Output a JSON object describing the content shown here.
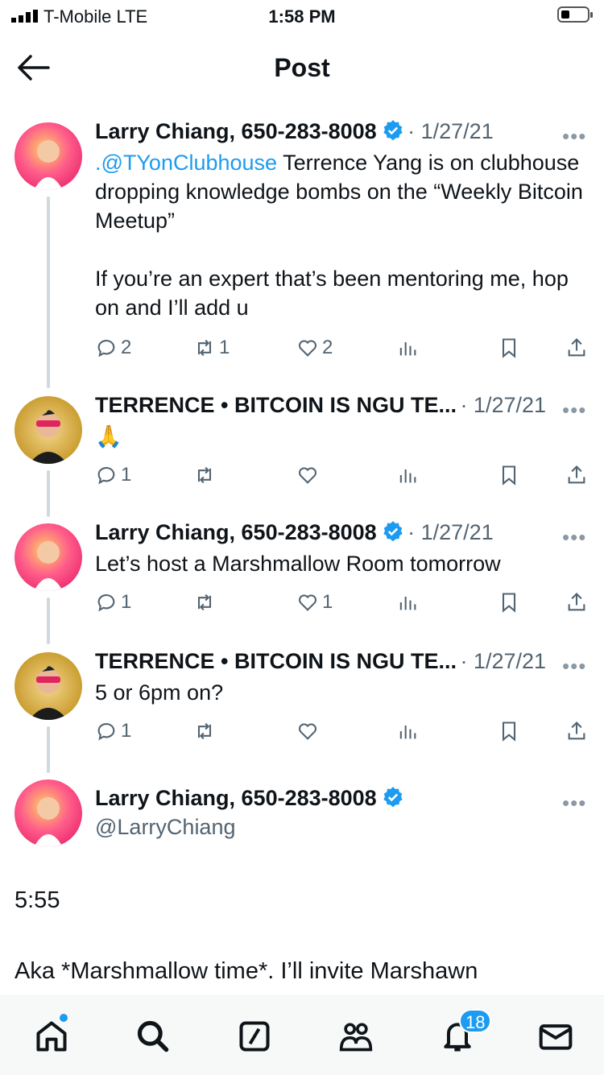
{
  "status_bar": {
    "carrier": "T-Mobile  LTE",
    "time": "1:58 PM"
  },
  "header": {
    "title": "Post"
  },
  "tweets": [
    {
      "name": "Larry Chiang, 650-283-8008",
      "date": "· 1/27/21",
      "mention": ".@TYonClubhouse",
      "text": " Terrence Yang is on clubhouse dropping knowledge bombs on the “Weekly Bitcoin Meetup”\n\nIf you’re an expert that’s been mentoring me, hop on and I’ll add u",
      "replies": "2",
      "reposts": "1",
      "likes": "2"
    },
    {
      "name": "TERRENCE • BITCOIN IS NGU TE...",
      "date": "· 1/27/21",
      "text": "🙏",
      "replies": "1",
      "reposts": "",
      "likes": ""
    },
    {
      "name": "Larry Chiang, 650-283-8008",
      "date": "· 1/27/21",
      "text": "Let’s host a Marshmallow Room tomorrow",
      "replies": "1",
      "reposts": "",
      "likes": "1"
    },
    {
      "name": "TERRENCE • BITCOIN IS NGU TE...",
      "date": "· 1/27/21",
      "text": "5 or 6pm on?",
      "replies": "1",
      "reposts": "",
      "likes": ""
    }
  ],
  "main_tweet": {
    "name": "Larry Chiang, 650-283-8008",
    "handle": "@LarryChiang",
    "line1": "5:55",
    "line2": "Aka *Marshmallow time*. I’ll invite Marshawn"
  },
  "more_label": "•••",
  "nav": {
    "notifications_badge": "18"
  },
  "colors": {
    "accent": "#1d9bf0",
    "secondary_text": "#536471"
  },
  "icons": [
    "back-arrow-icon",
    "verified-icon",
    "reply-icon",
    "repost-icon",
    "like-icon",
    "views-icon",
    "bookmark-icon",
    "share-icon",
    "home-icon",
    "search-icon",
    "grok-icon",
    "communities-icon",
    "notifications-icon",
    "messages-icon"
  ]
}
